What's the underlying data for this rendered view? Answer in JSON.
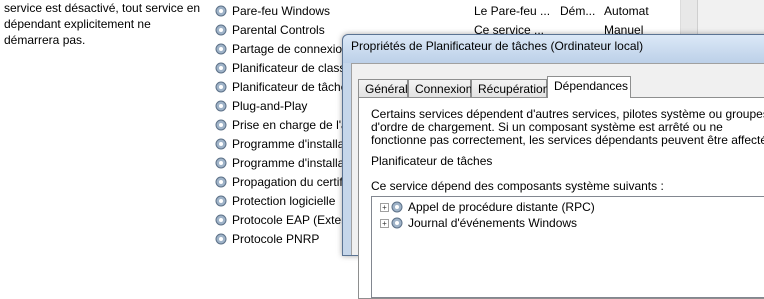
{
  "description": {
    "lines": [
      "service est désactivé, tout service en",
      "dépendant explicitement ne",
      "démarrera pas."
    ]
  },
  "services": [
    {
      "name": "Pare-feu Windows",
      "description": "Le Pare-feu ...",
      "status": "Dém...",
      "startup": "Automat"
    },
    {
      "name": "Parental Controls",
      "description": "Ce service ...",
      "status": "",
      "startup": "Manuel"
    },
    {
      "name": "Partage de connexion",
      "description": "",
      "status": "",
      "startup": ""
    },
    {
      "name": "Planificateur de classe",
      "description": "",
      "status": "",
      "startup": ""
    },
    {
      "name": "Planificateur de tâches",
      "description": "",
      "status": "",
      "startup": ""
    },
    {
      "name": "Plug-and-Play",
      "description": "",
      "status": "",
      "startup": ""
    },
    {
      "name": "Prise en charge de l'a",
      "description": "",
      "status": "",
      "startup": ""
    },
    {
      "name": "Programme d'installa",
      "description": "",
      "status": "",
      "startup": ""
    },
    {
      "name": "Programme d'installa",
      "description": "",
      "status": "",
      "startup": ""
    },
    {
      "name": "Propagation du certif",
      "description": "",
      "status": "",
      "startup": ""
    },
    {
      "name": "Protection logicielle",
      "description": "",
      "status": "",
      "startup": ""
    },
    {
      "name": "Protocole EAP (Exten",
      "description": "",
      "status": "",
      "startup": ""
    },
    {
      "name": "Protocole PNRP",
      "description": "",
      "status": "",
      "startup": ""
    }
  ],
  "dialog": {
    "title": "Propriétés de Planificateur de tâches (Ordinateur local)",
    "tabs": [
      "Général",
      "Connexion",
      "Récupération",
      "Dépendances"
    ],
    "active_tab": "Dépendances",
    "intro_lines": [
      "Certains services dépendent d'autres services, pilotes système ou groupes",
      "d'ordre de chargement. Si un composant système est arrêté ou ne",
      "fonctionne pas correctement, les services dépendants peuvent être affectés."
    ],
    "service_name": "Planificateur de tâches",
    "depends_label": "Ce service dépend des composants système suivants :",
    "dependencies": [
      "Appel de procédure distante (RPC)",
      "Journal d'événements Windows"
    ]
  }
}
